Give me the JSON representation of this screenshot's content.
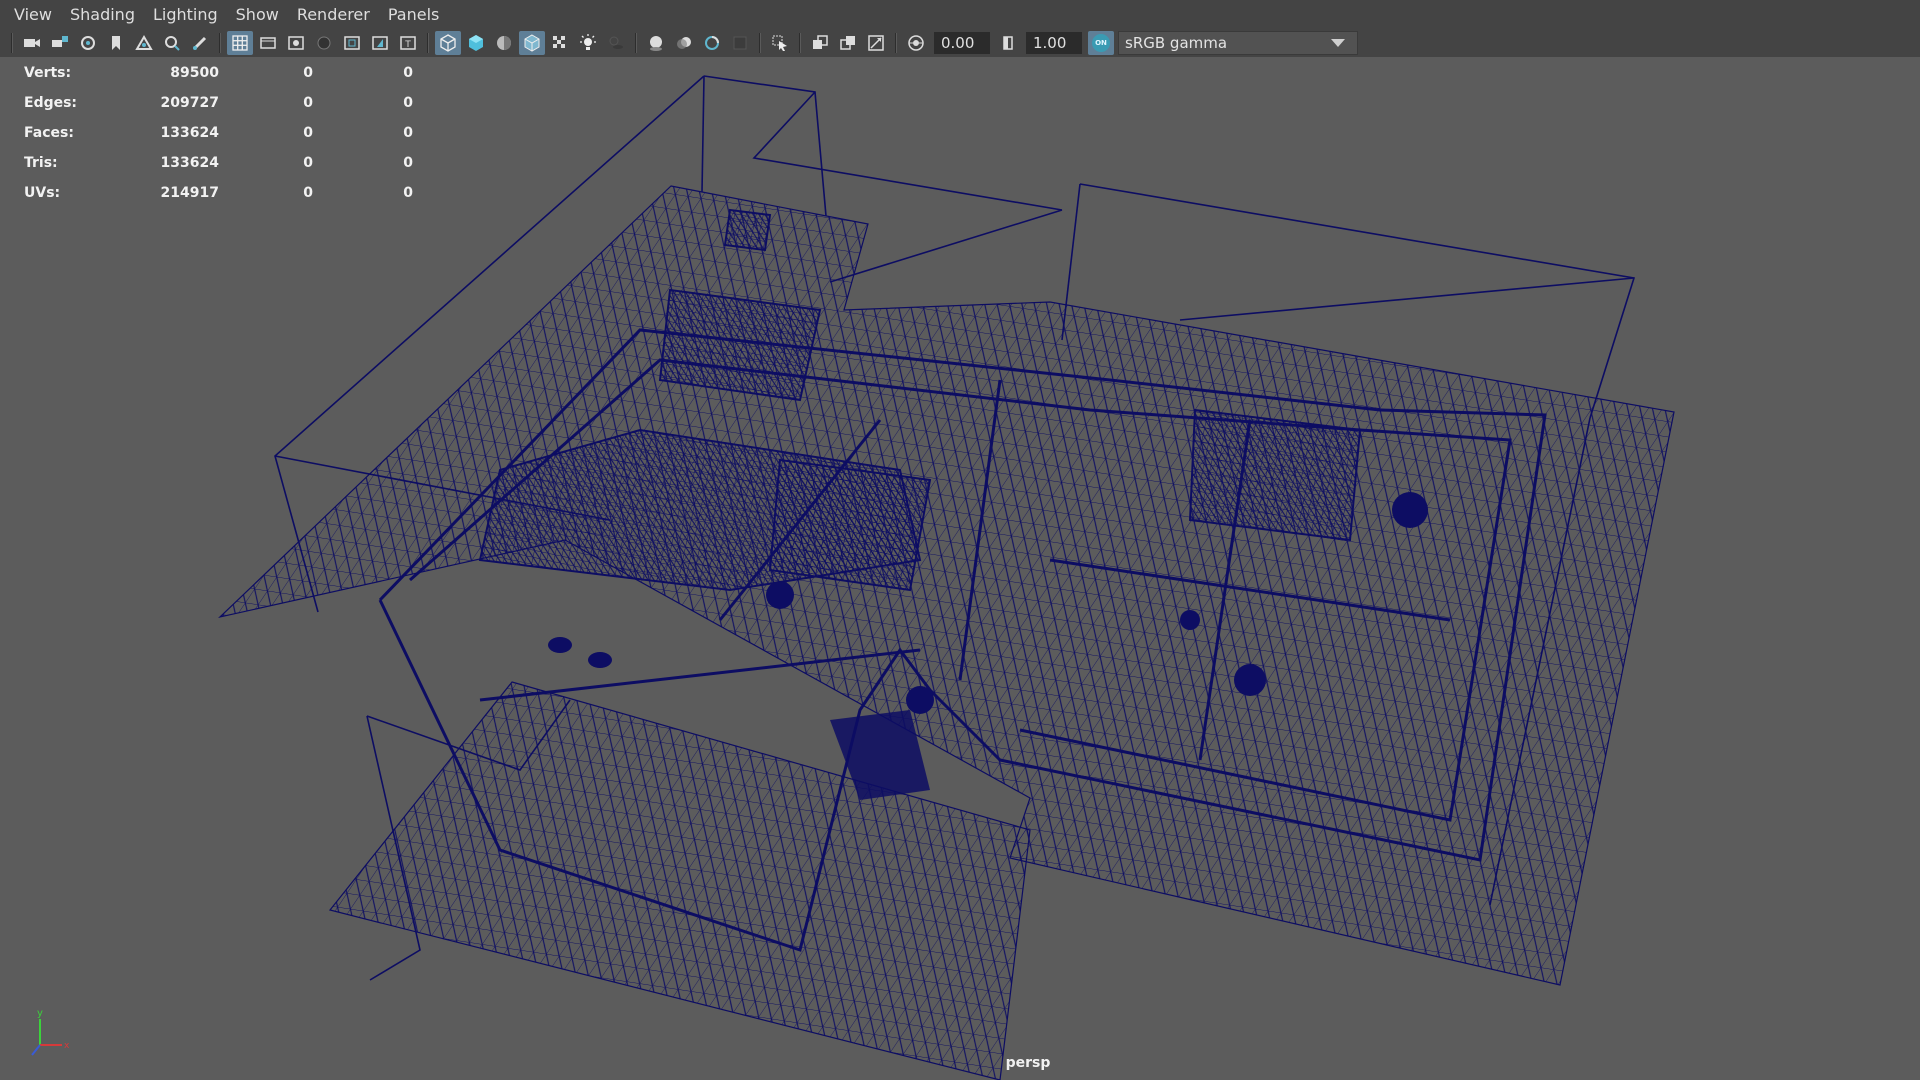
{
  "menu": [
    "View",
    "Shading",
    "Lighting",
    "Show",
    "Renderer",
    "Panels"
  ],
  "toolbar": {
    "exposure": "0.00",
    "gamma": "1.00",
    "color_management_badge": "ON",
    "color_space": "sRGB gamma",
    "icons": [
      "camera-icon",
      "camera-lock-icon",
      "camera-attributes-icon",
      "bookmark-icon",
      "image-plane-icon",
      "2d-pan-zoom-icon",
      "grease-pencil-icon",
      "grid-icon",
      "film-gate-icon",
      "resolution-gate-icon",
      "gate-mask-icon",
      "field-chart-icon",
      "safe-action-icon",
      "safe-title-icon",
      "wireframe-icon",
      "smooth-shade-icon",
      "default-material-icon",
      "wireframe-on-shaded-icon",
      "textured-icon",
      "use-lights-icon",
      "shadows-icon",
      "screen-space-ao-icon",
      "motion-blur-icon",
      "multisample-aa-icon",
      "depth-of-field-icon",
      "isolate-select-icon",
      "xray-icon",
      "xray-joints-icon",
      "backface-culling-icon",
      "exposure-icon",
      "gamma-icon",
      "view-transform-icon"
    ]
  },
  "stats": [
    {
      "label": "Verts:",
      "total": "89500",
      "selected": "0",
      "components": "0"
    },
    {
      "label": "Edges:",
      "total": "209727",
      "selected": "0",
      "components": "0"
    },
    {
      "label": "Faces:",
      "total": "133624",
      "selected": "0",
      "components": "0"
    },
    {
      "label": "Tris:",
      "total": "133624",
      "selected": "0",
      "components": "0"
    },
    {
      "label": "UVs:",
      "total": "214917",
      "selected": "0",
      "components": "0"
    }
  ],
  "viewport": {
    "camera": "persp",
    "wire_color": "#0d0d63",
    "background": "#5c5c5c"
  },
  "axis": {
    "x_color": "#d63a3a",
    "y_color": "#3bd23b",
    "z_color": "#3a5bd6",
    "y_label": "y",
    "x_label": "x"
  }
}
